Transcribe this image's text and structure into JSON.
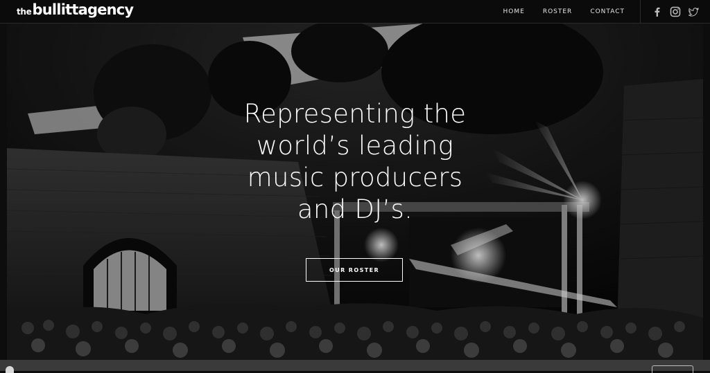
{
  "header": {
    "logo_prefix": "the",
    "logo_brand": "bullittagency",
    "nav": [
      {
        "label": "HOME"
      },
      {
        "label": "ROSTER"
      },
      {
        "label": "CONTACT"
      }
    ],
    "social": [
      {
        "icon": "facebook-icon"
      },
      {
        "icon": "instagram-icon"
      },
      {
        "icon": "twitter-icon"
      }
    ]
  },
  "hero": {
    "headline_lines": [
      "Representing the",
      "world’s leading",
      "music producers",
      "and DJ’s."
    ],
    "cta_label": "OUR ROSTER"
  },
  "colors": {
    "background": "#0d0d0d",
    "text": "#ffffff",
    "bottom_bar": "#3a3a3a"
  }
}
